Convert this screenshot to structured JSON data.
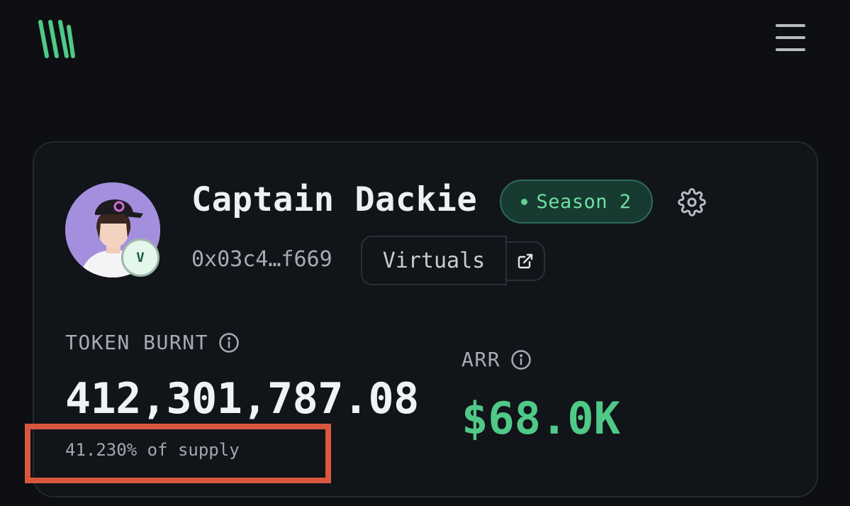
{
  "header": {
    "logo_icon": "brand-stripes-logo",
    "menu_icon": "hamburger-menu-icon"
  },
  "agent": {
    "name": "Captain Dackie",
    "avatar_badge": "V",
    "season_label": "Season 2",
    "address": "0x03c4…f669",
    "platform": "Virtuals",
    "external_link_icon": "external-link-icon",
    "settings_icon": "gear-icon"
  },
  "stats": {
    "token_burnt": {
      "label": "TOKEN BURNT",
      "value": "412,301,787.08",
      "supply_note": "41.230% of supply"
    },
    "arr": {
      "label": "ARR",
      "value": "$68.0K"
    }
  },
  "colors": {
    "background": "#0d0f13",
    "card": "#111419",
    "accent_green": "#4fc987",
    "highlight": "#d9573f"
  }
}
